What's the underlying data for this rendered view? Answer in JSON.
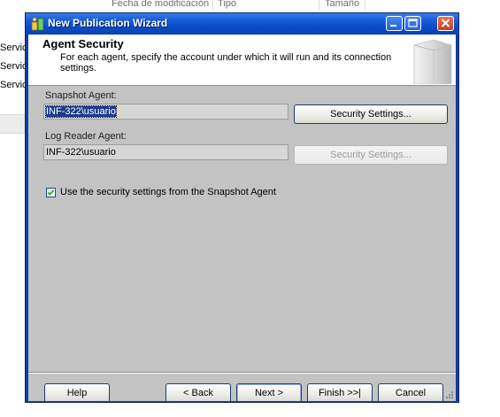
{
  "background_window": {
    "columns": [
      "Fecha de modificación",
      "Tipo",
      "Tamaño"
    ],
    "rows": [
      "Servic",
      "Servic",
      "Servic"
    ]
  },
  "dialog": {
    "title": "New Publication Wizard",
    "header": {
      "title": "Agent Security",
      "description": "For each agent, specify the account under which it will run and its connection settings."
    },
    "snapshot_agent": {
      "label": "Snapshot Agent:",
      "value": "INF-322\\usuario",
      "button": "Security Settings..."
    },
    "log_reader_agent": {
      "label": "Log Reader Agent:",
      "value": "INF-322\\usuario",
      "button": "Security Settings..."
    },
    "use_snapshot_settings": {
      "label": "Use the security settings from the Snapshot Agent",
      "checked": true
    },
    "footer": {
      "help": "Help",
      "back": "< Back",
      "next": "Next >",
      "finish": "Finish >>|",
      "cancel": "Cancel"
    }
  },
  "colors": {
    "titlebar": "#0a4ac4",
    "dialog_body": "#c3c3c3",
    "selection": "#1b3c8f"
  },
  "icons": [
    "wizard-app-icon",
    "minimize-icon",
    "maximize-icon",
    "close-icon",
    "wizard-header-graphic",
    "checkmark-icon",
    "resize-grip-icon"
  ]
}
